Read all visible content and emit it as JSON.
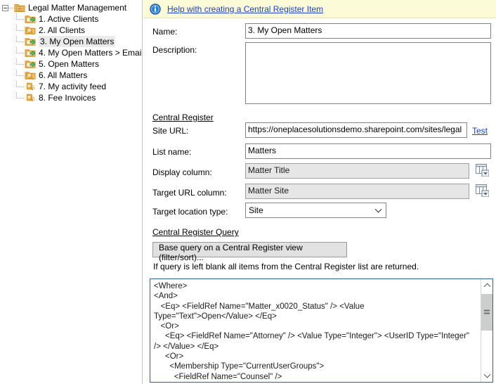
{
  "tree": {
    "root": {
      "label": "Legal Matter Management",
      "icon": "folder-lines-icon",
      "expanded": true
    },
    "items": [
      {
        "label": "1. Active Clients",
        "icon": "folder-arrow-icon",
        "selected": false
      },
      {
        "label": "2. All Clients",
        "icon": "folder-search-icon",
        "selected": false
      },
      {
        "label": "3. My Open Matters",
        "icon": "folder-arrow-icon",
        "selected": true
      },
      {
        "label": "4. My Open Matters > Email",
        "icon": "folder-arrow-icon",
        "selected": false
      },
      {
        "label": "5. Open Matters",
        "icon": "folder-arrow-icon",
        "selected": false
      },
      {
        "label": "6. All Matters",
        "icon": "folder-search-icon",
        "selected": false
      },
      {
        "label": "7. My activity feed",
        "icon": "search-dots-icon",
        "selected": false
      },
      {
        "label": "8. Fee Invoices",
        "icon": "search-dots-icon",
        "selected": false
      }
    ]
  },
  "help": {
    "icon": "info-icon",
    "link_text": "Help with creating a Central Register Item"
  },
  "form": {
    "name_label": "Name:",
    "name_value": "3. My Open Matters",
    "description_label": "Description:",
    "description_value": "",
    "description_placeholder": ""
  },
  "central_register": {
    "section_title": "Central Register",
    "site_url_label": "Site URL:",
    "site_url_value": "https://oneplacesolutionsdemo.sharepoint.com/sites/legal",
    "test_link": "Test",
    "list_name_label": "List name:",
    "list_name_value": "Matters",
    "display_column_label": "Display column:",
    "display_column_value": "Matter Title",
    "display_column_picker_icon": "column-picker-icon",
    "target_url_column_label": "Target URL column:",
    "target_url_column_value": "Matter Site",
    "target_url_column_picker_icon": "column-picker-icon",
    "target_location_type_label": "Target location type:",
    "target_location_type_value": "Site",
    "target_location_type_chevron": "chevron-down-icon"
  },
  "query": {
    "section_title": "Central Register Query",
    "base_query_button": "Base query on a Central Register view (filter/sort)...",
    "hint": "If query is left blank all items from the Central Register list are returned.",
    "xml": "<Where>\n<And>\n   <Eq> <FieldRef Name=\"Matter_x0020_Status\" /> <Value\nType=\"Text\">Open</Value> </Eq>\n   <Or>\n     <Eq> <FieldRef Name=\"Attorney\" /> <Value Type=\"Integer\"> <UserID Type=\"Integer\"\n/> </Value> </Eq>\n     <Or>\n       <Membership Type=\"CurrentUserGroups\">\n         <FieldRef Name=\"Counsel\" />",
    "scrollbar": {
      "up_icon": "scroll-up-arrow-icon",
      "down_icon": "scroll-down-arrow-icon",
      "thumb": "scrollbar-thumb"
    }
  },
  "colors": {
    "banner_bg": "#fbfbd7",
    "link": "#1f3fbf",
    "selection": "#eaeaea",
    "readonly_field": "#e6e6e6",
    "focus_border": "#2a6496",
    "folder": "#f0b04a"
  }
}
